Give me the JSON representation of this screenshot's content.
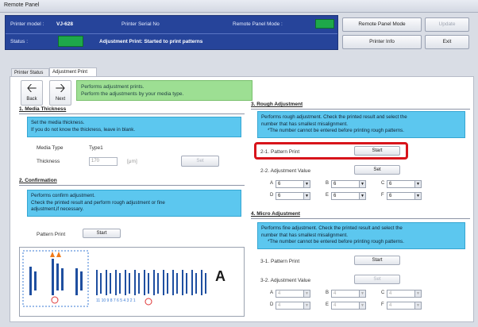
{
  "window": {
    "title": "Remote Panel"
  },
  "header": {
    "printer_model_label": "Printer model :",
    "printer_model": "VJ-628",
    "serial_label": "Printer Serial No",
    "remote_mode_label": "Remote Panel Mode :",
    "status_label": "Status :",
    "status_text": "Adjustment Print: Started to print patterns",
    "status_color": "#1ea84a"
  },
  "right_buttons": {
    "remote_panel_mode": "Remote Panel Mode",
    "update": "Update",
    "printer_info": "Printer Info",
    "exit": "Exit"
  },
  "tabs": [
    "Printer Status",
    "Adjustment Print"
  ],
  "nav": {
    "back": "Back",
    "next": "Next"
  },
  "info": {
    "line1": "Performs adjustment prints.",
    "line2": "Perform the adjustments by your media type."
  },
  "media": {
    "title": "1. Media Thickness",
    "desc1": "Set the media thickness.",
    "desc2": "If you do not know the thickness, leave in blank.",
    "type_label": "Media Type",
    "type_value": "Type1",
    "thickness_label": "Thickness",
    "thickness_value": "170",
    "unit": "[μm]",
    "set": "Set"
  },
  "confirm": {
    "title": "2. Confirmation",
    "desc1": "Performs confirm adjustment.",
    "desc2": "Check the printed result and perform rough adjustment or fine",
    "desc3": "adjustment,if necessary.",
    "pattern_label": "Pattern Print",
    "start": "Start"
  },
  "rough": {
    "title": "3. Rough Adjustment",
    "desc1": "Performs rough adjustment. Check the printed result and select the",
    "desc2": "number that has smallest misalignment.",
    "desc3": "*The number cannot be entered before printing rough patterns.",
    "pattern_label": "2-1. Pattern Print",
    "start": "Start",
    "value_label": "2-2. Adjustment Value",
    "set": "Set",
    "selects": [
      {
        "label": "A",
        "value": "6"
      },
      {
        "label": "B",
        "value": "6"
      },
      {
        "label": "C",
        "value": "6"
      },
      {
        "label": "D",
        "value": "6"
      },
      {
        "label": "E",
        "value": "6"
      },
      {
        "label": "F",
        "value": "6"
      }
    ]
  },
  "micro": {
    "title": "4. Micro Adjustment",
    "desc1": "Performs fine adjustment. Check the printed result and select the",
    "desc2": "number that has smallest misalignment.",
    "desc3": "*The number cannot be entered before printing rough patterns.",
    "pattern_label": "3-1. Pattern Print",
    "start": "Start",
    "value_label": "3-2. Adjustment Value",
    "set": "Set",
    "selects": [
      {
        "label": "A",
        "value": "4"
      },
      {
        "label": "B",
        "value": "4"
      },
      {
        "label": "C",
        "value": "4"
      },
      {
        "label": "D",
        "value": "4"
      },
      {
        "label": "E",
        "value": "4"
      },
      {
        "label": "F",
        "value": "4"
      }
    ]
  },
  "diagram": {
    "letter": "A",
    "scale": "11 10 9 8 7 6 5 4 3 2 1"
  }
}
